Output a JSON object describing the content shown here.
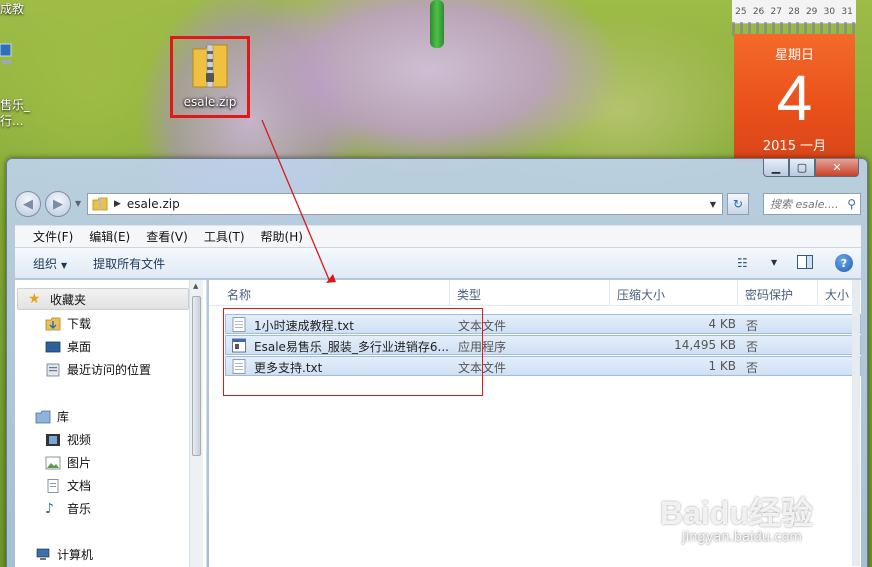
{
  "desktop": {
    "left_snippets": [
      "成教",
      "售乐_",
      "行..."
    ],
    "zip_icon_label": "esale.zip",
    "calendar": {
      "top_days": [
        "25",
        "26",
        "27",
        "28",
        "29",
        "30",
        "31"
      ],
      "weekday": "星期日",
      "day": "4",
      "month_year": "2015 一月"
    }
  },
  "window": {
    "controls": {
      "minimize": "▁",
      "maximize": "▢",
      "close": "✕"
    },
    "address": {
      "path": "esale.zip",
      "search_placeholder": "搜索 esale...."
    },
    "menu": [
      "文件(F)",
      "编辑(E)",
      "查看(V)",
      "工具(T)",
      "帮助(H)"
    ],
    "toolbar": {
      "organize_label": "组织",
      "extract_label": "提取所有文件"
    },
    "nav_pane": {
      "favorites_label": "收藏夹",
      "favorites": [
        "下载",
        "桌面",
        "最近访问的位置"
      ],
      "library_label": "库",
      "libraries": [
        "视频",
        "图片",
        "文档",
        "音乐"
      ],
      "computer_label": "计算机"
    },
    "columns": [
      "名称",
      "类型",
      "压缩大小",
      "密码保护",
      "大小"
    ],
    "files": [
      {
        "name": "1小时速成教程.txt",
        "type": "文本文件",
        "compressed": "4 KB",
        "password": "否",
        "icon": "text-file-icon"
      },
      {
        "name": "Esale易售乐_服装_多行业进销存6...",
        "type": "应用程序",
        "compressed": "14,495 KB",
        "password": "否",
        "icon": "application-icon"
      },
      {
        "name": "更多支持.txt",
        "type": "文本文件",
        "compressed": "1 KB",
        "password": "否",
        "icon": "text-file-icon"
      }
    ]
  },
  "watermark": {
    "brand": "Baidu经验",
    "url": "jingyan.baidu.com"
  },
  "colors": {
    "highlight_red": "#e01818",
    "selection_blue": "#cfe0f4"
  }
}
